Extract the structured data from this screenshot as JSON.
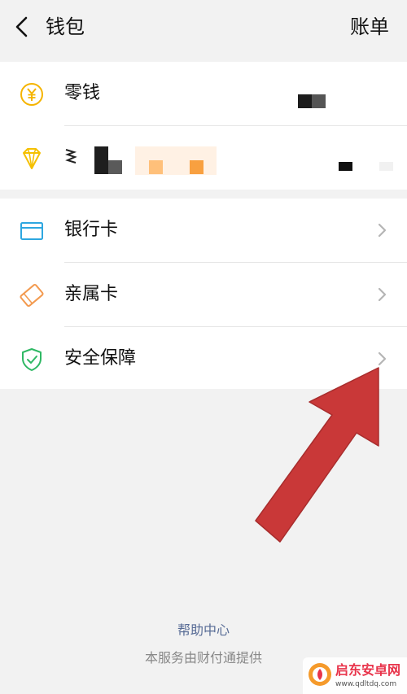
{
  "header": {
    "title": "钱包",
    "bill_label": "账单"
  },
  "assets": {
    "items": [
      {
        "label": "零钱",
        "icon": "yuan-coin-icon",
        "value": "[redacted]"
      },
      {
        "label": "",
        "icon": "diamond-icon",
        "value": "[redacted]"
      }
    ]
  },
  "services": {
    "items": [
      {
        "label": "银行卡",
        "icon": "bank-card-icon"
      },
      {
        "label": "亲属卡",
        "icon": "family-card-icon"
      },
      {
        "label": "安全保障",
        "icon": "shield-check-icon"
      }
    ]
  },
  "footer": {
    "help_label": "帮助中心",
    "provider_text": "本服务由财付通提供"
  },
  "watermark": {
    "name": "启东安卓网",
    "url": "www.qdltdq.com"
  },
  "colors": {
    "background": "#f2f2f2",
    "card": "#ffffff",
    "coin": "#f5b400",
    "diamond": "#f5c000",
    "bank_card": "#2ea7e0",
    "family_card": "#f39a4f",
    "shield": "#2fb864",
    "link": "#576b95",
    "annotation_arrow": "#c93838"
  }
}
